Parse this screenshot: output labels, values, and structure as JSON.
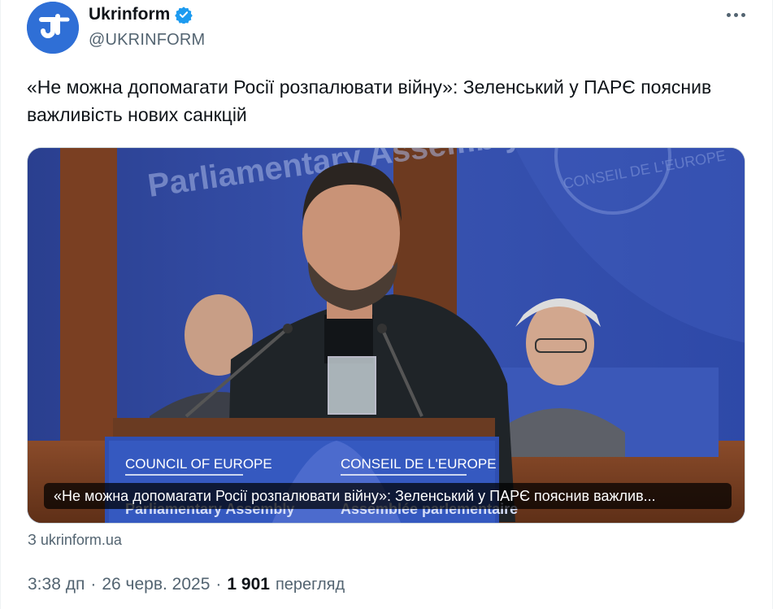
{
  "account": {
    "name": "Ukrinform",
    "handle": "@UKRINFORM",
    "avatar_icon": "ukrinform-logo-icon",
    "verified_icon": "verified-badge-icon",
    "brand_color": "#2f6fd6"
  },
  "more_icon": "more-dots-icon",
  "tweet": {
    "text": "«Не можна допомагати Росії розпалювати війну»: Зеленський у ПАРЄ пояснив важливість нових санкцій"
  },
  "media": {
    "caption": "«Не можна допомагати Росії розпалювати війну»: Зеленський у ПАРЄ пояснив важлив...",
    "podium_left": "COUNCIL OF EUROPE",
    "podium_right": "CONSEIL DE L'EUROPE",
    "podium_left_sub": "Parliamentary Assembly",
    "podium_right_sub": "Assemblée parlementaire",
    "banner_left": "Parliamentary Assembly",
    "banner_right": "CONSEIL DE L'EUROPE"
  },
  "link": {
    "source": "З ukrinform.ua"
  },
  "meta": {
    "time": "3:38 дп",
    "separator": "·",
    "date": "26 черв. 2025",
    "separator2": "·",
    "views_count": "1 901",
    "views_label": "перегляд"
  }
}
